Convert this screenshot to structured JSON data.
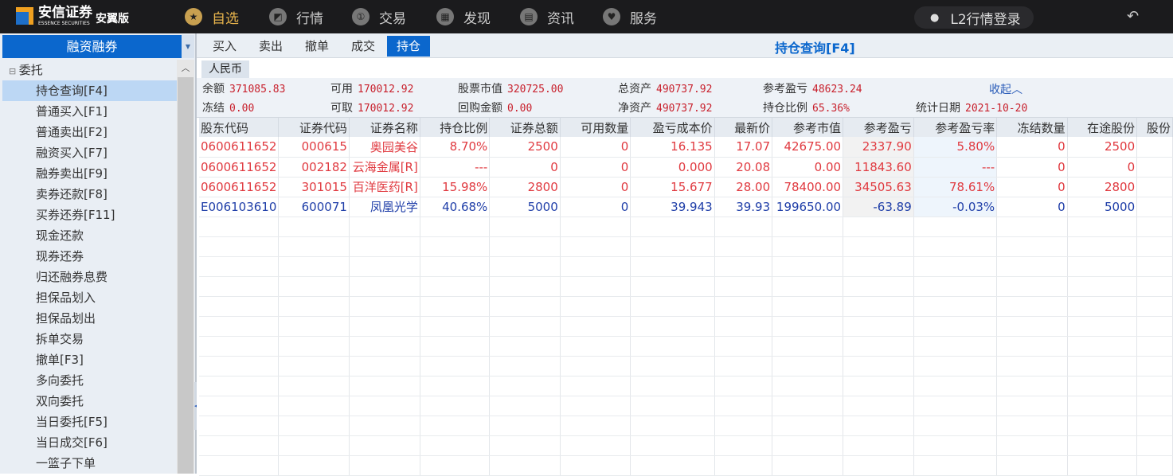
{
  "app": {
    "brand": "安信证券",
    "brand_en": "ESSENCE SECURITIES",
    "edition": "安翼版"
  },
  "nav": [
    {
      "label": "自选",
      "icon": "star-circle-icon",
      "active": true
    },
    {
      "label": "行情",
      "icon": "chart-icon"
    },
    {
      "label": "交易",
      "icon": "trade-icon"
    },
    {
      "label": "发现",
      "icon": "grid-icon"
    },
    {
      "label": "资讯",
      "icon": "document-icon"
    },
    {
      "label": "服务",
      "icon": "heart-icon"
    }
  ],
  "login": "L2行情登录",
  "sidebar": {
    "title": "融资融券",
    "root": "委托",
    "items": [
      "持仓查询[F4]",
      "普通买入[F1]",
      "普通卖出[F2]",
      "融资买入[F7]",
      "融券卖出[F9]",
      "卖券还款[F8]",
      "买券还券[F11]",
      "现金还款",
      "现券还券",
      "归还融券息费",
      "担保品划入",
      "担保品划出",
      "拆单交易",
      "撤单[F3]",
      "多向委托",
      "双向委托",
      "当日委托[F5]",
      "当日成交[F6]",
      "一篮子下单"
    ],
    "selected": 0
  },
  "tabs": [
    "买入",
    "卖出",
    "撤单",
    "成交",
    "持仓"
  ],
  "active_tab": 4,
  "page_title": "持仓查询[F4]",
  "currency": "人民币",
  "summary": {
    "row1": [
      {
        "k": "余额",
        "v": "371085.83"
      },
      {
        "k": "可用",
        "v": "170012.92"
      },
      {
        "k": "股票市值",
        "v": "320725.00"
      },
      {
        "k": "总资产",
        "v": "490737.92"
      },
      {
        "k": "参考盈亏",
        "v": "48623.24"
      }
    ],
    "row2": [
      {
        "k": "冻结",
        "v": "0.00"
      },
      {
        "k": "可取",
        "v": "170012.92"
      },
      {
        "k": "回购金额",
        "v": "0.00"
      },
      {
        "k": "净资产",
        "v": "490737.92"
      },
      {
        "k": "持仓比例",
        "v": "65.36%"
      },
      {
        "k": "统计日期",
        "v": "2021-10-20"
      }
    ],
    "collapse": "收起︿"
  },
  "table": {
    "headers": [
      "股东代码",
      "证券代码",
      "证券名称",
      "持仓比例",
      "证券总额",
      "可用数量",
      "盈亏成本价",
      "最新价",
      "参考市值",
      "参考盈亏",
      "参考盈亏率",
      "冻结数量",
      "在途股份",
      "股份"
    ],
    "rows": [
      {
        "color": "red",
        "cells": [
          "0600611652",
          "000615",
          "奥园美谷",
          "8.70%",
          "2500",
          "0",
          "16.135",
          "17.07",
          "42675.00",
          "2337.90",
          "5.80%",
          "0",
          "2500",
          ""
        ]
      },
      {
        "color": "red",
        "cells": [
          "0600611652",
          "002182",
          "云海金属[R]",
          "---",
          "0",
          "0",
          "0.000",
          "20.08",
          "0.00",
          "11843.60",
          "---",
          "0",
          "0",
          ""
        ]
      },
      {
        "color": "red",
        "cells": [
          "0600611652",
          "301015",
          "百洋医药[R]",
          "15.98%",
          "2800",
          "0",
          "15.677",
          "28.00",
          "78400.00",
          "34505.63",
          "78.61%",
          "0",
          "2800",
          ""
        ]
      },
      {
        "color": "blue",
        "cells": [
          "E006103610",
          "600071",
          "凤凰光学",
          "40.68%",
          "5000",
          "0",
          "39.943",
          "39.93",
          "199650.00",
          "-63.89",
          "-0.03%",
          "0",
          "5000",
          ""
        ]
      }
    ]
  },
  "colors": {
    "accent": "#0b67cd",
    "up": "#e03a40",
    "down": "#1f3ea8",
    "topbar": "#1b1b1d"
  }
}
